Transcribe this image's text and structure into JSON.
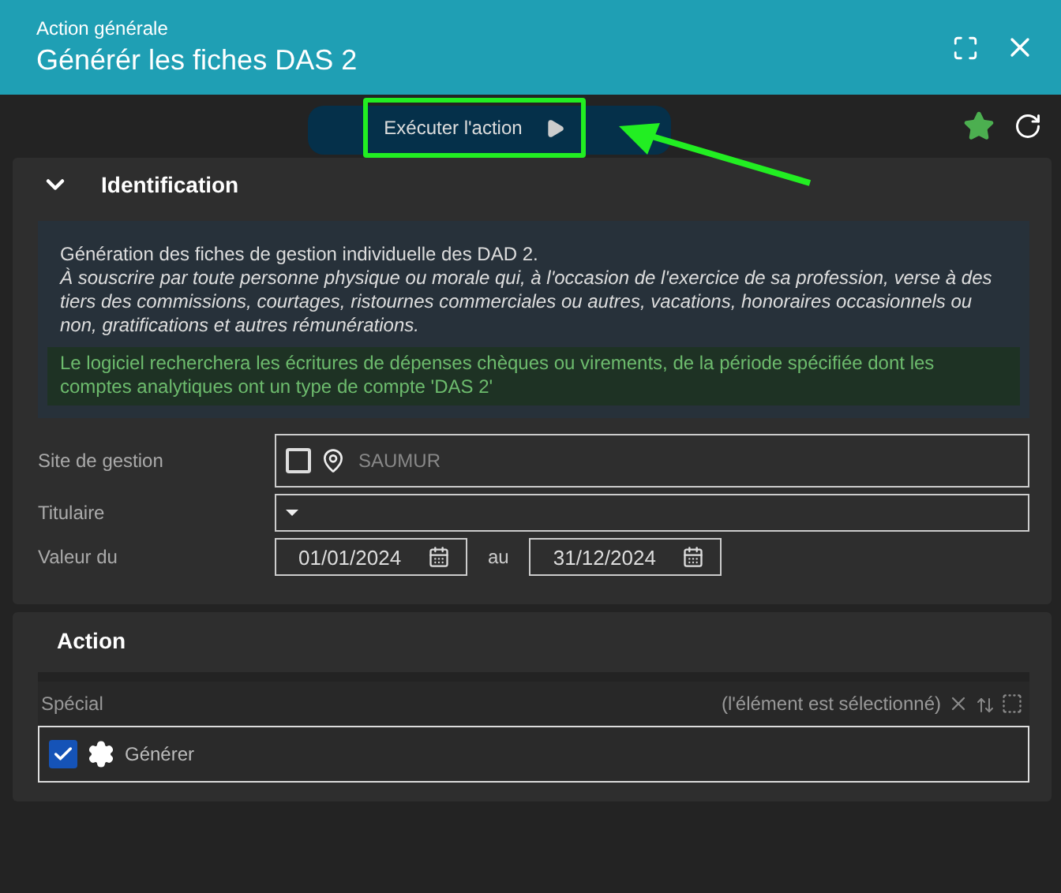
{
  "window": {
    "subtitle": "Action générale",
    "title": "Générér les fiches DAS 2"
  },
  "toolbar": {
    "run_button": "Exécuter l'action",
    "favorite": true
  },
  "annotation": {
    "highlight": true,
    "arrow": true
  },
  "identification": {
    "title": "Identification",
    "expanded": true,
    "description": "Génération des fiches de gestion individuelle des DAD 2.",
    "description_italic": "À souscrire par toute personne physique ou morale qui, à l'occasion de l'exercice de sa profession, verse à des tiers des commissions, courtages, ristournes commerciales ou autres, vacations, honoraires occasionnels ou non, gratifications et autres rémunérations.",
    "note": "Le logiciel recherchera les écritures de dépenses chèques ou virements, de la période spécifiée dont les comptes analytiques ont un type de compte 'DAS 2'",
    "fields": [
      {
        "kind": "site",
        "label": "Site de gestion",
        "checked": false,
        "placeholder": "SAUMUR"
      },
      {
        "kind": "select",
        "label": "Titulaire"
      },
      {
        "kind": "daterange",
        "label": "Valeur du",
        "from": "01/01/2024",
        "separator": "au",
        "to": "31/12/2024"
      }
    ]
  },
  "action": {
    "title": "Action",
    "list_label": "Spécial",
    "status": "(l'élément est sélectionné)",
    "items": [
      {
        "label": "Générer",
        "checked": true
      }
    ]
  }
}
